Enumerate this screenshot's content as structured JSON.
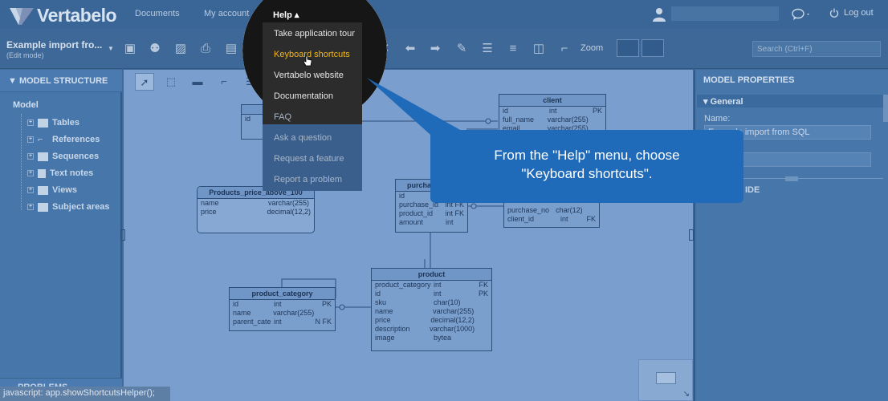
{
  "app": {
    "logo": "Vertabelo",
    "nav": {
      "documents": "Documents",
      "my_account": "My account",
      "help": "Help ▴"
    },
    "logout": "Log out"
  },
  "document": {
    "name": "Example import fro...",
    "mode": "(Edit mode)"
  },
  "toolbar": {
    "zoom_label": "Zoom",
    "search_placeholder": "Search (Ctrl+F)"
  },
  "left_panel": {
    "title": "MODEL STRUCTURE",
    "root": "Model",
    "items": [
      {
        "label": "Tables"
      },
      {
        "label": "References"
      },
      {
        "label": "Sequences"
      },
      {
        "label": "Text notes"
      },
      {
        "label": "Views"
      },
      {
        "label": "Subject areas"
      }
    ],
    "problems": "PROBLEMS"
  },
  "status_bar": "javascript: app.showShortcutsHelper();",
  "help_menu": {
    "items": [
      {
        "label": "Take application tour"
      },
      {
        "label": "Keyboard shortcuts"
      },
      {
        "label": "Vertabelo website"
      },
      {
        "label": "Documentation"
      },
      {
        "label": "FAQ"
      },
      {
        "label": "Ask a question"
      },
      {
        "label": "Request a feature"
      },
      {
        "label": "Report a problem"
      }
    ]
  },
  "callout": {
    "line1": "From the \"Help\" menu, choose",
    "line2": "\"Keyboard shortcuts\"."
  },
  "right_panel": {
    "title": "MODEL PROPERTIES",
    "section": "General",
    "name_label": "Name:",
    "name_value": "Example import from SQL",
    "section2": "IDE"
  },
  "tables": {
    "topleft": {
      "rows": [
        {
          "c1": "id",
          "c2": "",
          "c3": ""
        }
      ]
    },
    "client": {
      "name": "client",
      "rows": [
        {
          "c1": "id",
          "c2": "int",
          "c3": "PK"
        },
        {
          "c1": "full_name",
          "c2": "varchar(255)",
          "c3": ""
        },
        {
          "c1": "email",
          "c2": "varchar(255)",
          "c3": ""
        }
      ]
    },
    "view": {
      "name": "Products_price_above_100",
      "rows": [
        {
          "c1": "name",
          "c2": "varchar(255)",
          "c3": ""
        },
        {
          "c1": "price",
          "c2": "decimal(12,2)",
          "c3": ""
        }
      ]
    },
    "purchase_item": {
      "name": "purcha",
      "rows": [
        {
          "c1": "id",
          "c2": "",
          "c3": ""
        },
        {
          "c1": "purchase_id",
          "c2": "int FK",
          "c3": ""
        },
        {
          "c1": "product_id",
          "c2": "int FK",
          "c3": ""
        },
        {
          "c1": "amount",
          "c2": "int",
          "c3": ""
        }
      ]
    },
    "purchase": {
      "rows": [
        {
          "c1": "purchase_no",
          "c2": "char(12)",
          "c3": ""
        },
        {
          "c1": "client_id",
          "c2": "int",
          "c3": "FK"
        }
      ]
    },
    "product": {
      "name": "product",
      "rows": [
        {
          "c1": "product_category",
          "c2": "int",
          "c3": "FK"
        },
        {
          "c1": "id",
          "c2": "int",
          "c3": "PK"
        },
        {
          "c1": "sku",
          "c2": "char(10)",
          "c3": ""
        },
        {
          "c1": "name",
          "c2": "varchar(255)",
          "c3": ""
        },
        {
          "c1": "price",
          "c2": "decimal(12,2)",
          "c3": ""
        },
        {
          "c1": "description",
          "c2": "varchar(1000)",
          "c3": ""
        },
        {
          "c1": "image",
          "c2": "bytea",
          "c3": ""
        }
      ]
    },
    "product_category": {
      "name": "product_category",
      "rows": [
        {
          "c1": "id",
          "c2": "int",
          "c3": "PK"
        },
        {
          "c1": "name",
          "c2": "varchar(255)",
          "c3": ""
        },
        {
          "c1": "parent_cate",
          "c2": "int",
          "c3": "N FK"
        }
      ]
    }
  }
}
